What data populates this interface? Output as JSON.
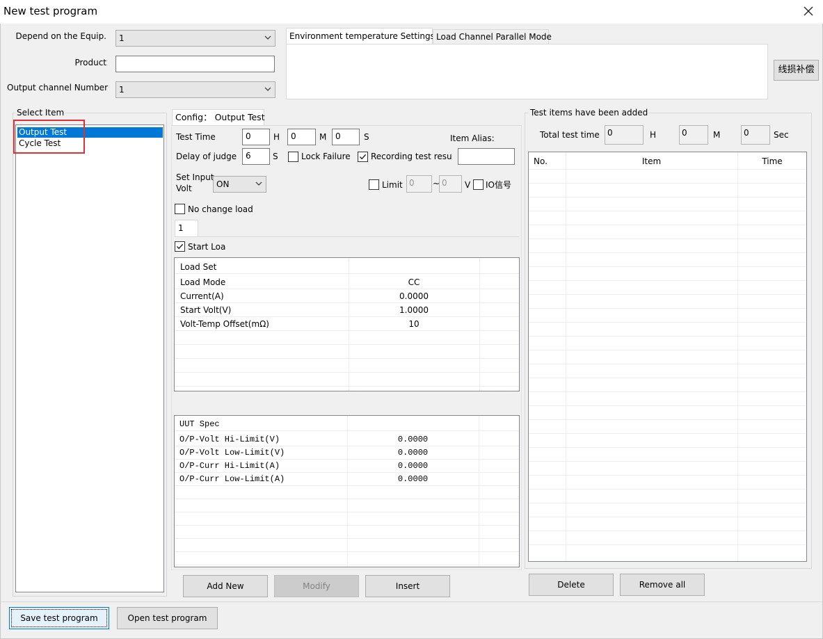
{
  "window": {
    "title": "New test program"
  },
  "form": {
    "equip_label": "Depend on the Equip.",
    "equip_value": "1",
    "product_label": "Product",
    "product_value": "",
    "channel_label": "Output channel Number",
    "channel_value": "1"
  },
  "env_tabs": [
    "Environment temperature Settings",
    "Load Channel Parallel Mode"
  ],
  "line_loss_button": "线损补偿",
  "select_item": {
    "caption": "Select Item",
    "items": [
      "Output Test",
      "Cycle Test"
    ]
  },
  "config": {
    "tab_label": "Config： Output Test",
    "test_time_label": "Test Time",
    "hours": "0",
    "h_unit": "H",
    "minutes": "0",
    "m_unit": "M",
    "seconds": "0",
    "s_unit": "S",
    "item_alias_label": "Item Alias:",
    "item_alias_value": "",
    "delay_label": "Delay of judge",
    "delay_value": "6",
    "delay_unit": "S",
    "lock_failure_label": "Lock Failure",
    "recording_label": "Recording test resul",
    "set_input_label_1": "Set Input",
    "set_input_label_2": "Volt",
    "set_input_value": "ON",
    "limit_label": "Limit",
    "limit_low": "0",
    "limit_tilde": "~",
    "limit_high": "0",
    "limit_unit": "V",
    "io_label": "IO信号",
    "no_change_label": "No change load",
    "channel_tab": "1",
    "start_load_label": "Start Loa"
  },
  "load_set": {
    "header": "Load Set",
    "rows": [
      {
        "name": "Load Mode",
        "value": "CC"
      },
      {
        "name": "Current(A)",
        "value": "0.0000"
      },
      {
        "name": "Start Volt(V)",
        "value": "1.0000"
      },
      {
        "name": "Volt-Temp Offset(mΩ)",
        "value": "10"
      }
    ]
  },
  "uut_spec": {
    "header": "UUT Spec",
    "rows": [
      {
        "name": "O/P-Volt Hi-Limit(V)",
        "value": "0.0000"
      },
      {
        "name": "O/P-Volt Low-Limit(V)",
        "value": "0.0000"
      },
      {
        "name": "O/P-Curr Hi-Limit(A)",
        "value": "0.0000"
      },
      {
        "name": "O/P-Curr Low-Limit(A)",
        "value": "0.0000"
      }
    ]
  },
  "middle_buttons": {
    "add_new": "Add New",
    "modify": "Modify",
    "insert": "Insert"
  },
  "added_items": {
    "caption": "Test items have been added",
    "total_time_label": "Total test time",
    "total_h": "0",
    "h_unit": "H",
    "total_m": "0",
    "m_unit": "M",
    "total_s": "0",
    "s_unit": "Sec",
    "columns": [
      "No.",
      "Item",
      "Time"
    ]
  },
  "right_buttons": {
    "delete": "Delete",
    "remove_all": "Remove all"
  },
  "bottom_buttons": {
    "save": "Save test program",
    "open": "Open test program"
  },
  "colors": {
    "selection": "#0078d7",
    "highlight_box": "#e0302f",
    "face": "#f0f0f0"
  }
}
